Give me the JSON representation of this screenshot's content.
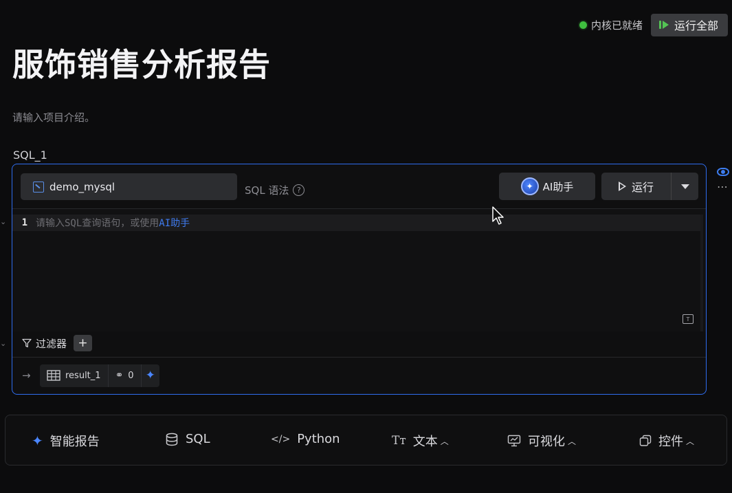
{
  "header": {
    "kernel_status": "内核已就绪",
    "run_all_label": "运行全部",
    "colors": {
      "kernel_ok": "#3fbf3f",
      "run_all_icon": "#54c454"
    }
  },
  "document": {
    "title": "服饰销售分析报告",
    "description_placeholder": "请输入项目介绍。"
  },
  "cell": {
    "label": "SQL_1",
    "datasource": "demo_mysql",
    "syntax_label": "SQL 语法",
    "ai_button": "AI助手",
    "run_button": "运行",
    "editor": {
      "line_number": "1",
      "placeholder_prefix": "请输入SQL查询语句，或使用",
      "placeholder_link": "AI助手"
    },
    "filter_label": "过滤器",
    "filter_add": "+",
    "result": {
      "name": "result_1",
      "link_count": "0"
    },
    "accent_color": "#2f6df0"
  },
  "insert_bar": {
    "items": [
      {
        "label": "智能报告",
        "icon": "magic-wand-icon"
      },
      {
        "label": "SQL",
        "icon": "database-icon"
      },
      {
        "label": "Python",
        "icon": "code-icon"
      },
      {
        "label": "文本",
        "icon": "text-icon"
      },
      {
        "label": "可视化",
        "icon": "chart-icon"
      },
      {
        "label": "控件",
        "icon": "widget-icon"
      }
    ]
  }
}
